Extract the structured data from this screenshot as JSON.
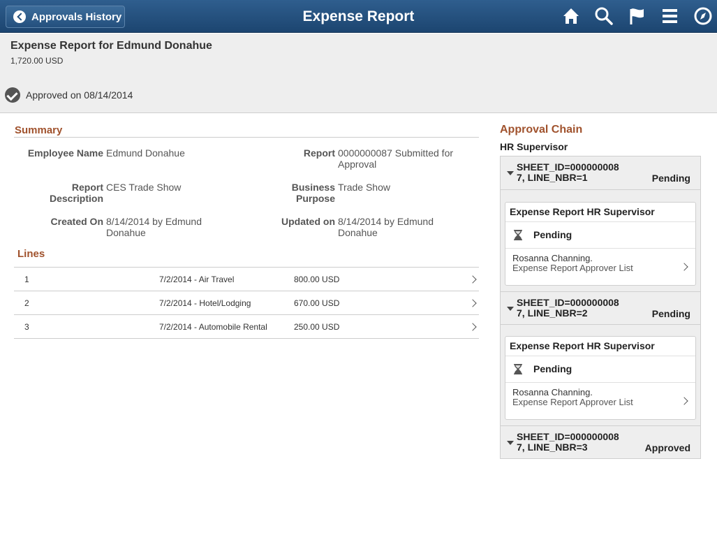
{
  "header": {
    "back_label": "Approvals History",
    "title": "Expense Report",
    "icons": [
      "home-icon",
      "search-icon",
      "flag-icon",
      "menu-icon",
      "navigator-icon"
    ]
  },
  "banner": {
    "title": "Expense Report for Edmund Donahue",
    "amount": "1,720.00 USD",
    "status": "Approved on 08/14/2014"
  },
  "summary": {
    "heading": "Summary",
    "fields": [
      {
        "label": "Employee Name",
        "value": "Edmund Donahue"
      },
      {
        "label": "Report",
        "value": "0000000087 Submitted for Approval"
      },
      {
        "label": "Report Description",
        "value": "CES Trade Show"
      },
      {
        "label": "Business Purpose",
        "value": "Trade Show"
      },
      {
        "label": "Created On",
        "value": "8/14/2014 by Edmund Donahue"
      },
      {
        "label": "Updated on",
        "value": "8/14/2014 by Edmund Donahue"
      }
    ]
  },
  "lines": {
    "heading": "Lines",
    "rows": [
      {
        "num": "1",
        "desc": "7/2/2014 - Air Travel",
        "amount": "800.00 USD"
      },
      {
        "num": "2",
        "desc": "7/2/2014 - Hotel/Lodging",
        "amount": "670.00 USD"
      },
      {
        "num": "3",
        "desc": "7/2/2014 - Automobile Rental",
        "amount": "250.00 USD"
      }
    ]
  },
  "approval_chain": {
    "heading": "Approval Chain",
    "group": "HR Supervisor",
    "steps": [
      {
        "sheet_l1": "SHEET_ID=000000008",
        "sheet_l2": "7, LINE_NBR=1",
        "status": "Pending",
        "card": {
          "title": "Expense Report HR Supervisor",
          "status": "Pending",
          "approver": "Rosanna Channing.",
          "list": "Expense Report Approver List"
        }
      },
      {
        "sheet_l1": "SHEET_ID=000000008",
        "sheet_l2": "7, LINE_NBR=2",
        "status": "Pending",
        "card": {
          "title": "Expense Report HR Supervisor",
          "status": "Pending",
          "approver": "Rosanna Channing.",
          "list": "Expense Report Approver List"
        }
      },
      {
        "sheet_l1": "SHEET_ID=000000008",
        "sheet_l2": "7, LINE_NBR=3",
        "status": "Approved"
      }
    ]
  },
  "colors": {
    "header": "#24507e",
    "section_heading": "#a0522d",
    "panel": "#eeeeee"
  }
}
